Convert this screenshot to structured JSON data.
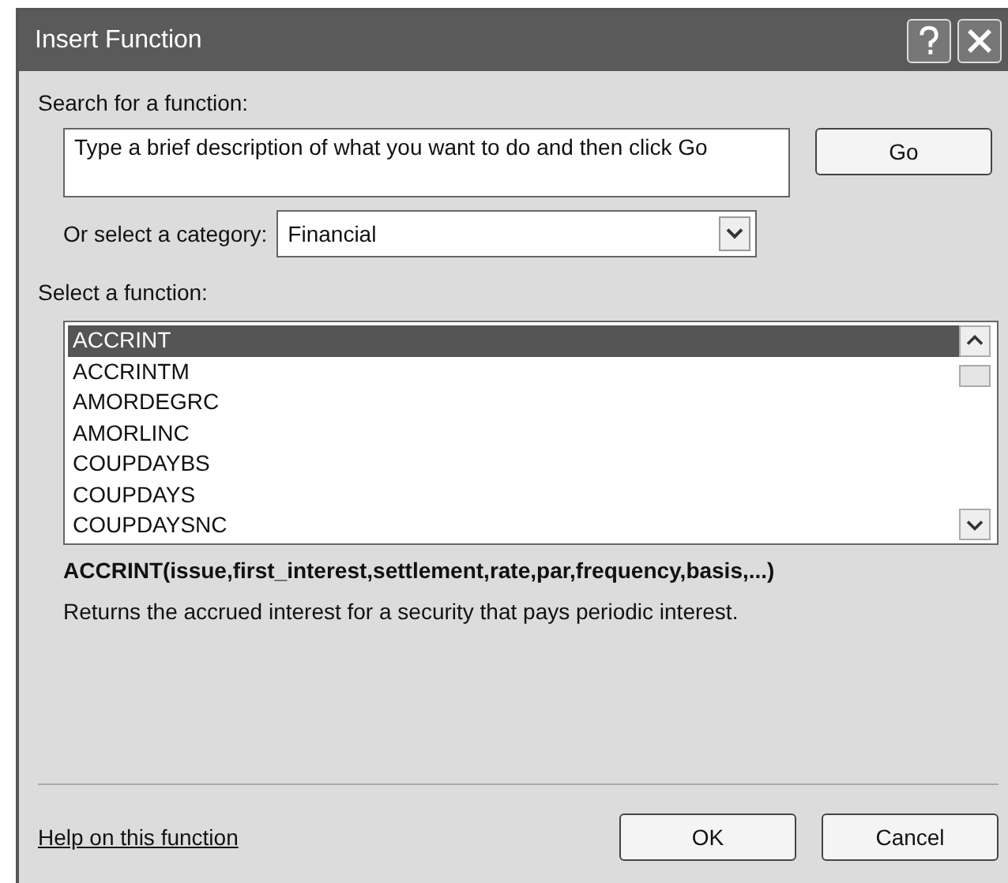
{
  "window": {
    "title": "Insert Function"
  },
  "search": {
    "label": "Search for a function:",
    "value": "Type a brief description of what you want to do and then click Go",
    "button": "Go"
  },
  "category": {
    "label": "Or select a category:",
    "value": "Financial"
  },
  "functions": {
    "label": "Select a function:",
    "items": [
      {
        "name": "ACCRINT",
        "selected": true
      },
      {
        "name": "ACCRINTM",
        "selected": false
      },
      {
        "name": "AMORDEGRC",
        "selected": false
      },
      {
        "name": "AMORLINC",
        "selected": false
      },
      {
        "name": "COUPDAYBS",
        "selected": false
      },
      {
        "name": "COUPDAYS",
        "selected": false
      },
      {
        "name": "COUPDAYSNC",
        "selected": false
      }
    ]
  },
  "syntax": "ACCRINT(issue,first_interest,settlement,rate,par,frequency,basis,...)",
  "description": "Returns the accrued interest for a security that pays periodic interest.",
  "help_link": "Help on this function",
  "buttons": [
    "OK",
    "Cancel"
  ]
}
